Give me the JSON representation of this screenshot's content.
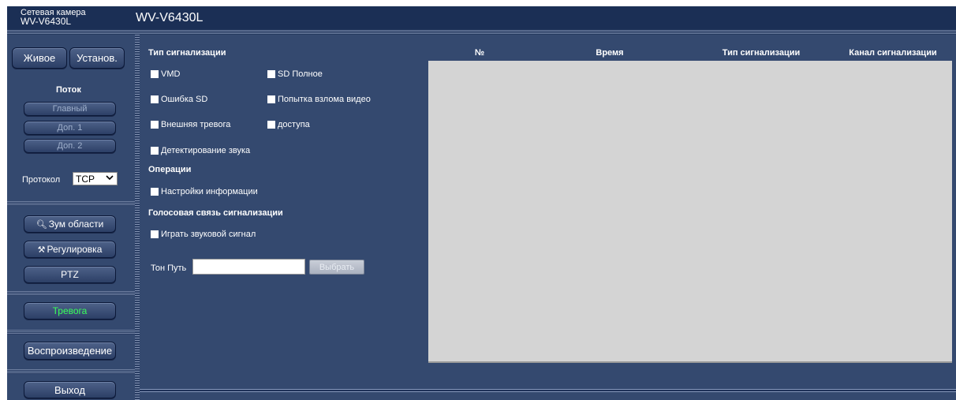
{
  "header": {
    "brand_line1": "Сетевая камера",
    "brand_line2": "WV-V6430L",
    "model_title": "WV-V6430L"
  },
  "sidebar": {
    "live_button": "Живое",
    "setup_button": "Установ.",
    "stream_heading": "Поток",
    "stream_buttons": [
      "Главный",
      "Доп. 1",
      "Доп. 2"
    ],
    "protocol_label": "Протокол",
    "protocol_value": "TCP",
    "zoom_area_button": "Зум области",
    "adjust_button": "Регулировка",
    "ptz_button": "PTZ",
    "alarm_button": "Тревога",
    "playback_button": "Воспроизведение",
    "exit_button": "Выход"
  },
  "alarm_type": {
    "title": "Тип сигнализации",
    "vmd": "VMD",
    "sd_full": "SD Полное",
    "sd_error": "Ошибка SD",
    "video_tamper": "Попытка взлома видео",
    "external_alarm": "Внешняя тревога",
    "access": "доступа",
    "audio_detection": "Детектирование звука"
  },
  "operations": {
    "title": "Операции",
    "info_settings": "Настройки информации"
  },
  "voice_alarm": {
    "title": "Голосовая связь сигнализации",
    "play_sound": "Играть звуковой сигнал",
    "tone_path_label": "Тон Путь",
    "tone_path_value": "",
    "select_button": "Выбрать"
  },
  "table": {
    "columns": [
      "№",
      "Время",
      "Тип сигнализации",
      "Канал сигнализации"
    ],
    "rows": []
  },
  "colors": {
    "header_bg": "#1b2f55",
    "panel_bg": "#34496f",
    "alarm_text": "#39ff5a",
    "table_body": "#d4d4d4"
  }
}
